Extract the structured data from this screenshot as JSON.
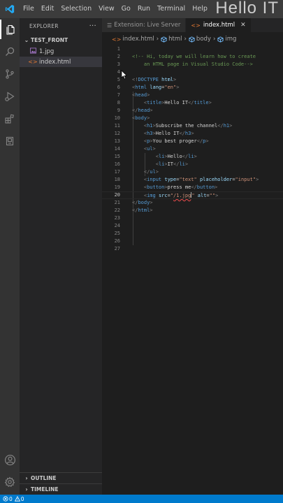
{
  "menu": [
    "File",
    "Edit",
    "Selection",
    "View",
    "Go",
    "Run",
    "Terminal",
    "Help"
  ],
  "watermark": "Hello IT",
  "sidebar": {
    "header": "EXPLORER",
    "more": "···",
    "folder": "TEST_FRONT",
    "files": [
      {
        "name": "1.jpg",
        "icon": "image-file-icon"
      },
      {
        "name": "index.html",
        "icon": "html-file-icon"
      }
    ],
    "outline": "OUTLINE",
    "timeline": "TIMELINE"
  },
  "tabs": [
    {
      "label": "Extension: Live Server"
    },
    {
      "label": "index.html"
    }
  ],
  "breadcrumb": [
    "index.html",
    "html",
    "body",
    "img"
  ],
  "editor": {
    "current_line": 20,
    "lines": [
      "",
      "<!-- Hi, today we will learn how to create",
      "    an HTML page in Visual Studio Code-->",
      "",
      "<!DOCTYPE html>",
      "<html lang=\"en\">",
      "<head>",
      "    <title>Hello IT</title>",
      "</head>",
      "<body>",
      "    <h1>Subscribe the channel</h1>",
      "    <h3>Hello IT</h3>",
      "    <p>You best proger</p>",
      "    <ul>",
      "        <li>Hello</li>",
      "        <li>IT</li>",
      "    </ul>",
      "    <input type=\"text\" placeholder=\"input\">",
      "    <button>press me</button>",
      "    <img src=\"/1.jpg\" alt=\"\">",
      "</body>",
      "</html>",
      "",
      "",
      "",
      "",
      ""
    ]
  },
  "status": {
    "errors": "0",
    "warnings": "0"
  },
  "colors": {
    "accent": "#007acc",
    "editor_bg": "#1e1e1e",
    "sidebar_bg": "#252526"
  }
}
